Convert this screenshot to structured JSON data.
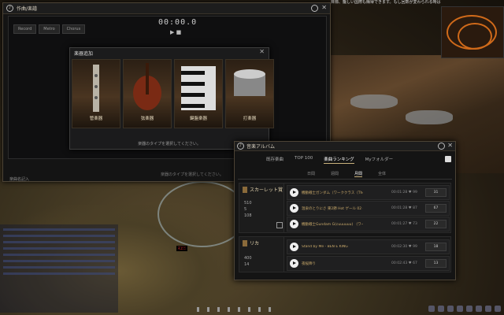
{
  "composer": {
    "title": "作曲/楽譜",
    "toolbar_buttons": [
      "Record",
      "Metro",
      "Chorus"
    ],
    "time": "00:00.0",
    "bottom_hint": "楽器のタイプを選択してください。",
    "side_label": "楽曲名記入"
  },
  "instrument_dialog": {
    "title": "楽器追加",
    "instruments": [
      "管楽器",
      "弦楽器",
      "鍵盤楽器",
      "打楽器"
    ],
    "hint": "楽器のタイプを選択してください。"
  },
  "album": {
    "title": "音楽アルバム",
    "tabs": [
      "既存楽曲",
      "TOP 100",
      "楽曲ランキング",
      "Myフォルダー"
    ],
    "active_tab": "楽曲ランキング",
    "subtabs": [
      "日間",
      "週間",
      "月間",
      "全体"
    ],
    "active_subtab": "月間",
    "groups": [
      {
        "title": "スカーレット賞",
        "stats": [
          "510",
          "5",
          "108"
        ],
        "rows": [
          {
            "title": "機動戦士ガンダム（ワーククラス（Theme）",
            "meta": "00:01:28 ♥ 99",
            "count": "31"
          },
          {
            "title": "温泉のとりにさ 東2節 Hot ゲール 02 (ヴァ",
            "meta": "00:01:28 ♥ 87",
            "count": "67"
          },
          {
            "title": "機動戦士Gundam G(cuuuuuu) （ワークク",
            "meta": "00:01:27 ♥ 73",
            "count": "22"
          }
        ]
      },
      {
        "title": "リカ",
        "stats": [
          "400",
          "14"
        ],
        "rows": [
          {
            "title": "Stand by Me - BEN E KING",
            "meta": "00:02:30 ♥ 99",
            "count": "18"
          },
          {
            "title": "夜桜降り",
            "meta": "00:02:43 ♥ 67",
            "count": "13"
          }
        ]
      }
    ]
  },
  "hud": {
    "topbar": "目標、籠しい国際も購得できます。もし回数が変わられる時は",
    "player_name": "ﾈｺﾐﾐ"
  }
}
